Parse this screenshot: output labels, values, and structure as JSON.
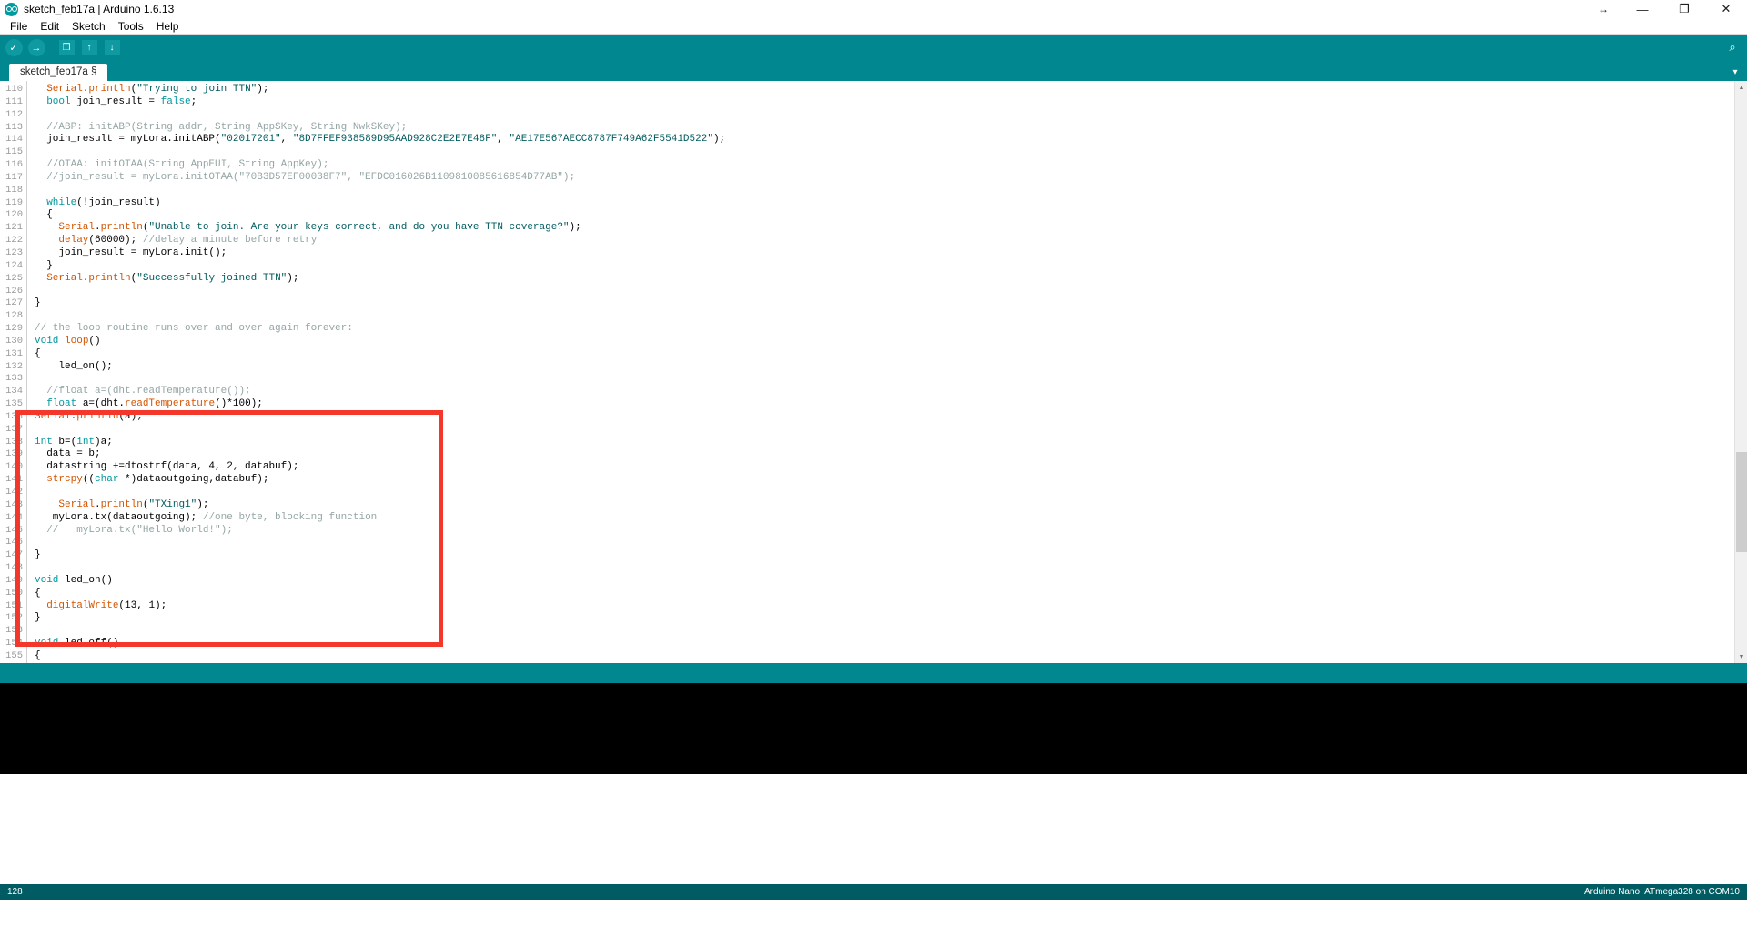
{
  "window": {
    "title": "sketch_feb17a | Arduino 1.6.13",
    "logo_icon": "arduino-logo-icon",
    "controls": {
      "resize_icon": "↔",
      "minimize_icon": "—",
      "maximize_icon": "❐",
      "close_icon": "✕"
    }
  },
  "menubar": {
    "items": [
      {
        "label": "File"
      },
      {
        "label": "Edit"
      },
      {
        "label": "Sketch"
      },
      {
        "label": "Tools"
      },
      {
        "label": "Help"
      }
    ]
  },
  "toolbar": {
    "verify_icon": "✓",
    "upload_icon": "→",
    "new_icon": "❒",
    "open_icon": "↑",
    "save_icon": "↓",
    "serial_monitor_icon": "⌕"
  },
  "tabs": {
    "active": "sketch_feb17a §",
    "menu_icon": "▾"
  },
  "editor": {
    "first_line": 110,
    "lines": [
      {
        "n": 110,
        "tokens": [
          {
            "t": "  ",
            "c": ""
          },
          {
            "t": "Serial",
            "c": "fn"
          },
          {
            "t": ".",
            "c": ""
          },
          {
            "t": "println",
            "c": "fn"
          },
          {
            "t": "(",
            "c": ""
          },
          {
            "t": "\"Trying to join TTN\"",
            "c": "str"
          },
          {
            "t": ");",
            "c": ""
          }
        ]
      },
      {
        "n": 111,
        "tokens": [
          {
            "t": "  ",
            "c": ""
          },
          {
            "t": "bool",
            "c": "kw"
          },
          {
            "t": " join_result = ",
            "c": ""
          },
          {
            "t": "false",
            "c": "kw"
          },
          {
            "t": ";",
            "c": ""
          }
        ]
      },
      {
        "n": 112,
        "tokens": []
      },
      {
        "n": 113,
        "tokens": [
          {
            "t": "  ",
            "c": ""
          },
          {
            "t": "//ABP: initABP(String addr, String AppSKey, String NwkSKey);",
            "c": "cmt"
          }
        ]
      },
      {
        "n": 114,
        "tokens": [
          {
            "t": "  join_result = myLora.initABP(",
            "c": ""
          },
          {
            "t": "\"02017201\"",
            "c": "str"
          },
          {
            "t": ", ",
            "c": ""
          },
          {
            "t": "\"8D7FFEF938589D95AAD928C2E2E7E48F\"",
            "c": "str"
          },
          {
            "t": ", ",
            "c": ""
          },
          {
            "t": "\"AE17E567AECC8787F749A62F5541D522\"",
            "c": "str"
          },
          {
            "t": ");",
            "c": ""
          }
        ]
      },
      {
        "n": 115,
        "tokens": []
      },
      {
        "n": 116,
        "tokens": [
          {
            "t": "  ",
            "c": ""
          },
          {
            "t": "//OTAA: initOTAA(String AppEUI, String AppKey);",
            "c": "cmt"
          }
        ]
      },
      {
        "n": 117,
        "tokens": [
          {
            "t": "  ",
            "c": ""
          },
          {
            "t": "//join_result = myLora.initOTAA(\"70B3D57EF00038F7\", \"EFDC016026B1109810085616854D77AB\");",
            "c": "cmt"
          }
        ]
      },
      {
        "n": 118,
        "tokens": []
      },
      {
        "n": 119,
        "tokens": [
          {
            "t": "  ",
            "c": ""
          },
          {
            "t": "while",
            "c": "kw"
          },
          {
            "t": "(!join_result)",
            "c": ""
          }
        ]
      },
      {
        "n": 120,
        "tokens": [
          {
            "t": "  {",
            "c": ""
          }
        ]
      },
      {
        "n": 121,
        "tokens": [
          {
            "t": "    ",
            "c": ""
          },
          {
            "t": "Serial",
            "c": "fn"
          },
          {
            "t": ".",
            "c": ""
          },
          {
            "t": "println",
            "c": "fn"
          },
          {
            "t": "(",
            "c": ""
          },
          {
            "t": "\"Unable to join. Are your keys correct, and do you have TTN coverage?\"",
            "c": "str"
          },
          {
            "t": ");",
            "c": ""
          }
        ]
      },
      {
        "n": 122,
        "tokens": [
          {
            "t": "    ",
            "c": ""
          },
          {
            "t": "delay",
            "c": "fn"
          },
          {
            "t": "(",
            "c": ""
          },
          {
            "t": "60000",
            "c": ""
          },
          {
            "t": "); ",
            "c": ""
          },
          {
            "t": "//delay a minute before retry",
            "c": "cmt"
          }
        ]
      },
      {
        "n": 123,
        "tokens": [
          {
            "t": "    join_result = myLora.init();",
            "c": ""
          }
        ]
      },
      {
        "n": 124,
        "tokens": [
          {
            "t": "  }",
            "c": ""
          }
        ]
      },
      {
        "n": 125,
        "tokens": [
          {
            "t": "  ",
            "c": ""
          },
          {
            "t": "Serial",
            "c": "fn"
          },
          {
            "t": ".",
            "c": ""
          },
          {
            "t": "println",
            "c": "fn"
          },
          {
            "t": "(",
            "c": ""
          },
          {
            "t": "\"Successfully joined TTN\"",
            "c": "str"
          },
          {
            "t": ");",
            "c": ""
          }
        ]
      },
      {
        "n": 126,
        "tokens": []
      },
      {
        "n": 127,
        "tokens": [
          {
            "t": "}",
            "c": ""
          }
        ]
      },
      {
        "n": 128,
        "tokens": [],
        "caret": true
      },
      {
        "n": 129,
        "tokens": [
          {
            "t": "// the loop routine runs over and over again forever:",
            "c": "cmt"
          }
        ]
      },
      {
        "n": 130,
        "tokens": [
          {
            "t": "void",
            "c": "kw"
          },
          {
            "t": " ",
            "c": ""
          },
          {
            "t": "loop",
            "c": "fn"
          },
          {
            "t": "()",
            "c": ""
          }
        ]
      },
      {
        "n": 131,
        "tokens": [
          {
            "t": "{",
            "c": ""
          }
        ]
      },
      {
        "n": 132,
        "tokens": [
          {
            "t": "    led_on();",
            "c": ""
          }
        ]
      },
      {
        "n": 133,
        "tokens": []
      },
      {
        "n": 134,
        "tokens": [
          {
            "t": "  ",
            "c": ""
          },
          {
            "t": "//float a=(dht.readTemperature());",
            "c": "cmt"
          }
        ]
      },
      {
        "n": 135,
        "tokens": [
          {
            "t": "  ",
            "c": ""
          },
          {
            "t": "float",
            "c": "kw"
          },
          {
            "t": " a=(dht.",
            "c": ""
          },
          {
            "t": "readTemperature",
            "c": "fn"
          },
          {
            "t": "()*100);",
            "c": ""
          }
        ]
      },
      {
        "n": 136,
        "tokens": [
          {
            "t": "Serial",
            "c": "fn"
          },
          {
            "t": ".",
            "c": ""
          },
          {
            "t": "println",
            "c": "fn"
          },
          {
            "t": "(a);",
            "c": ""
          }
        ]
      },
      {
        "n": 137,
        "tokens": []
      },
      {
        "n": 138,
        "tokens": [
          {
            "t": "int",
            "c": "kw"
          },
          {
            "t": " b=(",
            "c": ""
          },
          {
            "t": "int",
            "c": "kw"
          },
          {
            "t": ")a;",
            "c": ""
          }
        ]
      },
      {
        "n": 139,
        "tokens": [
          {
            "t": "  data = b;",
            "c": ""
          }
        ]
      },
      {
        "n": 140,
        "tokens": [
          {
            "t": "  datastring +=dtostrf(data, 4, 2, databuf);",
            "c": ""
          }
        ]
      },
      {
        "n": 141,
        "tokens": [
          {
            "t": "  ",
            "c": ""
          },
          {
            "t": "strcpy",
            "c": "fn"
          },
          {
            "t": "((",
            "c": ""
          },
          {
            "t": "char",
            "c": "kw"
          },
          {
            "t": " *)dataoutgoing,databuf);",
            "c": ""
          }
        ]
      },
      {
        "n": 142,
        "tokens": []
      },
      {
        "n": 143,
        "tokens": [
          {
            "t": "    ",
            "c": ""
          },
          {
            "t": "Serial",
            "c": "fn"
          },
          {
            "t": ".",
            "c": ""
          },
          {
            "t": "println",
            "c": "fn"
          },
          {
            "t": "(",
            "c": ""
          },
          {
            "t": "\"TXing1\"",
            "c": "str"
          },
          {
            "t": ");",
            "c": ""
          }
        ]
      },
      {
        "n": 144,
        "tokens": [
          {
            "t": "   myLora.tx(dataoutgoing); ",
            "c": ""
          },
          {
            "t": "//one byte, blocking function",
            "c": "cmt"
          }
        ]
      },
      {
        "n": 145,
        "tokens": [
          {
            "t": "  ",
            "c": ""
          },
          {
            "t": "//   myLora.tx(\"Hello World!\");",
            "c": "cmt"
          }
        ]
      },
      {
        "n": 146,
        "tokens": []
      },
      {
        "n": 147,
        "tokens": [
          {
            "t": "}",
            "c": ""
          }
        ]
      },
      {
        "n": 148,
        "tokens": []
      },
      {
        "n": 149,
        "tokens": [
          {
            "t": "void",
            "c": "kw"
          },
          {
            "t": " led_on()",
            "c": ""
          }
        ]
      },
      {
        "n": 150,
        "tokens": [
          {
            "t": "{",
            "c": ""
          }
        ]
      },
      {
        "n": 151,
        "tokens": [
          {
            "t": "  ",
            "c": ""
          },
          {
            "t": "digitalWrite",
            "c": "fn"
          },
          {
            "t": "(",
            "c": ""
          },
          {
            "t": "13",
            "c": ""
          },
          {
            "t": ", ",
            "c": ""
          },
          {
            "t": "1",
            "c": ""
          },
          {
            "t": ");",
            "c": ""
          }
        ]
      },
      {
        "n": 152,
        "tokens": [
          {
            "t": "}",
            "c": ""
          }
        ]
      },
      {
        "n": 153,
        "tokens": []
      },
      {
        "n": 154,
        "tokens": [
          {
            "t": "void",
            "c": "kw"
          },
          {
            "t": " led_off()",
            "c": ""
          }
        ]
      },
      {
        "n": 155,
        "tokens": [
          {
            "t": "{",
            "c": ""
          }
        ]
      }
    ],
    "scrollbar": {
      "up_icon": "▲",
      "down_icon": "▼"
    }
  },
  "annotation": {
    "color": "#f4372b",
    "shape": "rectangle-highlight"
  },
  "statusbar": {
    "line_number": "128",
    "board_info": "Arduino Nano, ATmega328 on COM10"
  },
  "colors": {
    "teal": "#00878f",
    "teal_dark": "#005c62",
    "keyword": "#00979c",
    "function": "#d35400",
    "string": "#005c5f",
    "comment": "#95a5a6"
  }
}
